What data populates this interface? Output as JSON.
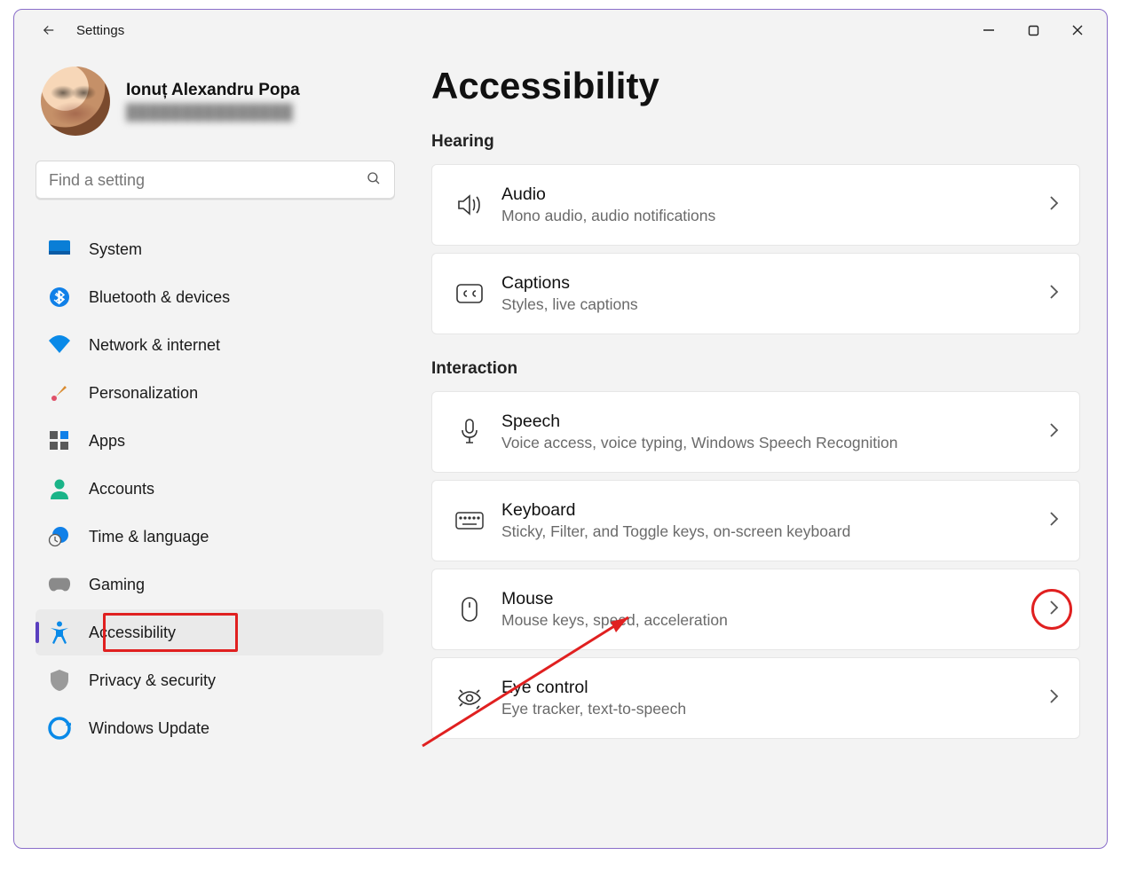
{
  "app_title": "Settings",
  "user": {
    "name": "Ionuț Alexandru Popa",
    "email_masked": "███████████████"
  },
  "search": {
    "placeholder": "Find a setting"
  },
  "sidebar": {
    "items": [
      {
        "label": "System",
        "icon": "system"
      },
      {
        "label": "Bluetooth & devices",
        "icon": "bluetooth"
      },
      {
        "label": "Network & internet",
        "icon": "wifi"
      },
      {
        "label": "Personalization",
        "icon": "brush"
      },
      {
        "label": "Apps",
        "icon": "apps"
      },
      {
        "label": "Accounts",
        "icon": "person"
      },
      {
        "label": "Time & language",
        "icon": "clock"
      },
      {
        "label": "Gaming",
        "icon": "gamepad"
      },
      {
        "label": "Accessibility",
        "icon": "accessibility",
        "active": true,
        "highlight": true
      },
      {
        "label": "Privacy & security",
        "icon": "shield"
      },
      {
        "label": "Windows Update",
        "icon": "update"
      }
    ]
  },
  "main": {
    "title": "Accessibility",
    "sections": [
      {
        "title": "Hearing",
        "items": [
          {
            "id": "audio",
            "title": "Audio",
            "subtitle": "Mono audio, audio notifications"
          },
          {
            "id": "captions",
            "title": "Captions",
            "subtitle": "Styles, live captions"
          }
        ]
      },
      {
        "title": "Interaction",
        "items": [
          {
            "id": "speech",
            "title": "Speech",
            "subtitle": "Voice access, voice typing, Windows Speech Recognition"
          },
          {
            "id": "keyboard",
            "title": "Keyboard",
            "subtitle": "Sticky, Filter, and Toggle keys, on-screen keyboard"
          },
          {
            "id": "mouse",
            "title": "Mouse",
            "subtitle": "Mouse keys, speed, acceleration",
            "highlight_chevron": true
          },
          {
            "id": "eye-control",
            "title": "Eye control",
            "subtitle": "Eye tracker, text-to-speech"
          }
        ]
      }
    ]
  }
}
